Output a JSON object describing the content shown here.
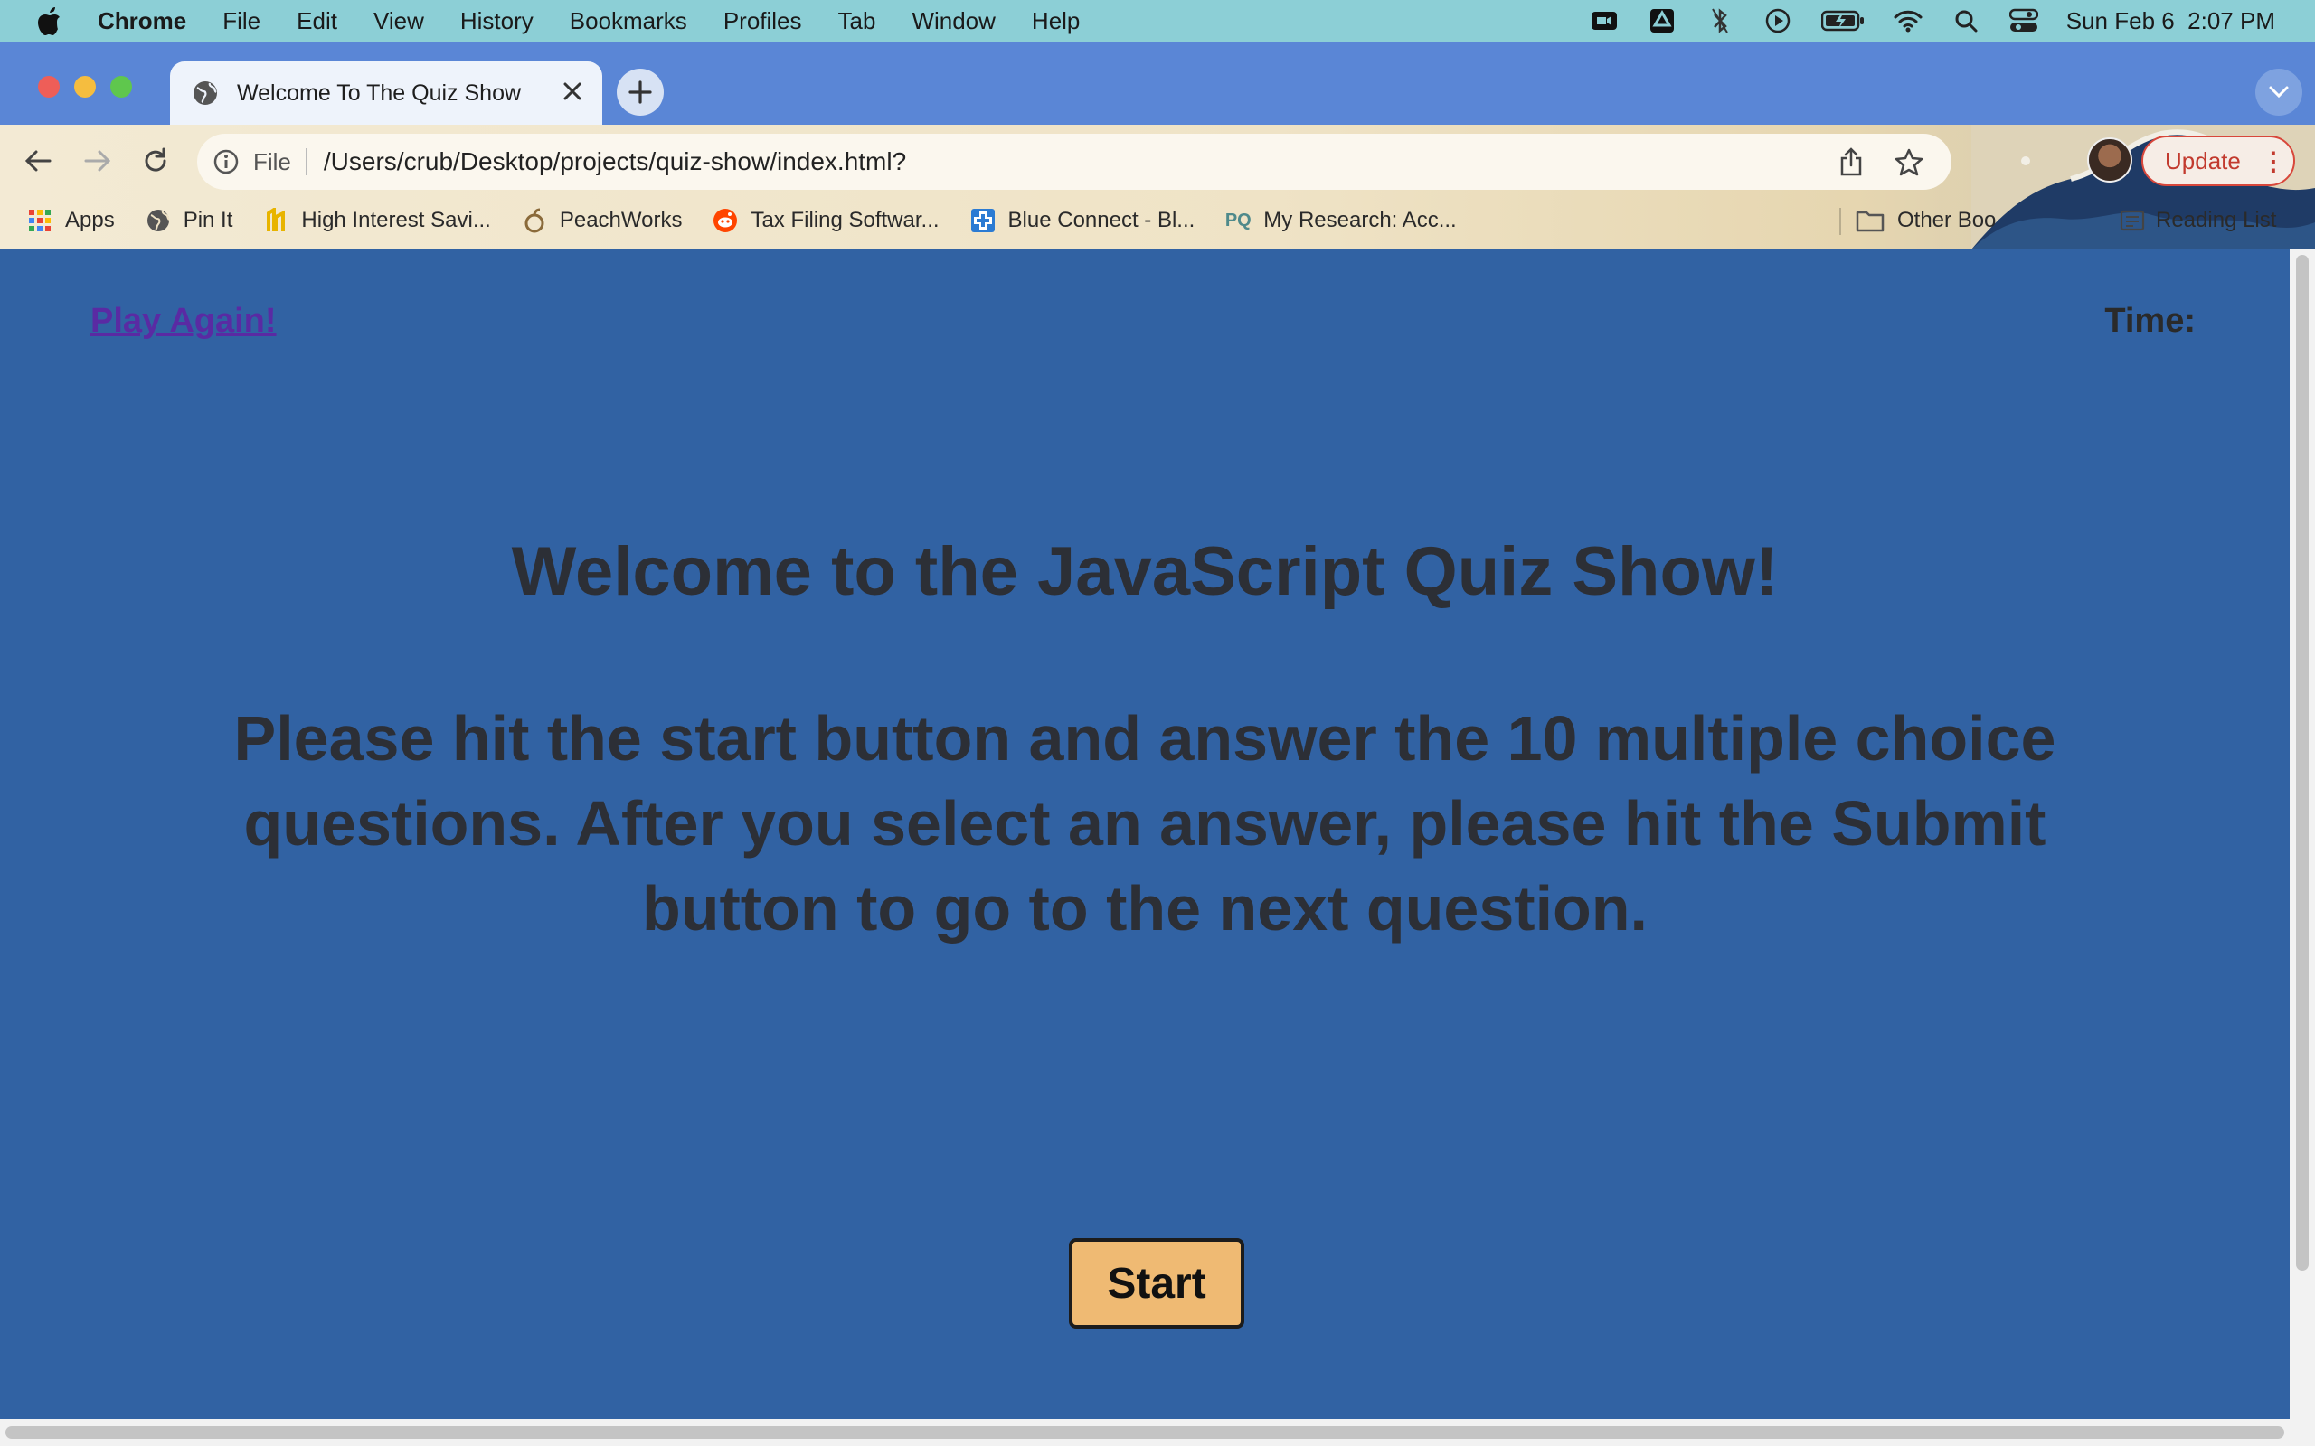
{
  "menubar": {
    "items": [
      "Chrome",
      "File",
      "Edit",
      "View",
      "History",
      "Bookmarks",
      "Profiles",
      "Tab",
      "Window",
      "Help"
    ],
    "datetime": "Sun Feb 6  2:07 PM",
    "status_icons": [
      "zoom-icon",
      "drive-icon",
      "bluetooth-icon",
      "play-icon",
      "battery-icon",
      "wifi-icon",
      "spotlight-icon",
      "control-center-icon"
    ]
  },
  "browser": {
    "tab_title": "Welcome To The Quiz Show",
    "omnibox_scheme": "File",
    "url": "/Users/crub/Desktop/projects/quiz-show/index.html?",
    "update_label": "Update",
    "bookmarks": [
      {
        "label": "Apps",
        "icon": "apps-grid-icon"
      },
      {
        "label": "Pin It",
        "icon": "globe-icon"
      },
      {
        "label": "High Interest Savi...",
        "icon": "bank-icon"
      },
      {
        "label": "PeachWorks",
        "icon": "peach-icon"
      },
      {
        "label": "Tax Filing Softwar...",
        "icon": "reddit-icon"
      },
      {
        "label": "Blue Connect - Bl...",
        "icon": "bluecross-icon"
      },
      {
        "label": "My Research: Acc...",
        "icon": "pq-icon"
      }
    ],
    "other_bookmarks": "Other Boo",
    "reading_list": "Reading List"
  },
  "page": {
    "play_again": "Play Again!",
    "timer_label": "Time:",
    "heading": "Welcome to the JavaScript Quiz Show!",
    "instructions": "Please hit the start button and answer the 10 multiple choice questions. After you select an answer, please hit the Submit button to go to the next question.",
    "start_label": "Start"
  },
  "colors": {
    "page_background": "#3162a3",
    "start_button": "#efba73",
    "link": "#5a2aa3",
    "text": "#2c2f36"
  }
}
